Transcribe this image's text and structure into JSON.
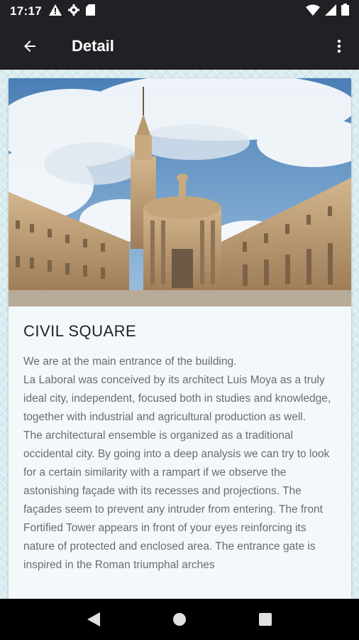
{
  "status_bar": {
    "time": "17:17",
    "icons_left": [
      "warning-icon",
      "settings-icon",
      "sd-card-icon"
    ],
    "icons_right": [
      "wifi-icon",
      "signal-icon",
      "battery-icon"
    ]
  },
  "app_bar": {
    "title": "Detail",
    "back_icon": "arrow-back-icon",
    "menu_icon": "more-vert-icon"
  },
  "detail": {
    "image_alt": "La Laboral building civil square",
    "title": "CIVIL SQUARE",
    "paragraphs": [
      "We are at the main entrance of the building.",
      "La Laboral was conceived by its architect Luis Moya as a truly ideal city, independent, focused both in studies and knowledge, together with industrial and agricultural production as well.",
      "The architectural ensemble is organized as a traditional occidental city. By going into a deep analysis we can try to look for a certain similarity with a rampart if we observe the astonishing façade with its recesses and projections. The façades seem to prevent any intruder from entering. The front Fortified Tower appears in front of your eyes reinforcing its nature of protected and enclosed area. The entrance gate is inspired in the Roman triumphal arches"
    ]
  },
  "nav_bar": {
    "buttons": [
      "back-triangle-icon",
      "home-circle-icon",
      "recents-square-icon"
    ]
  },
  "colors": {
    "bar": "#202124",
    "card": "#f3f9fb",
    "text": "#6b6b6b",
    "title": "#222222"
  }
}
